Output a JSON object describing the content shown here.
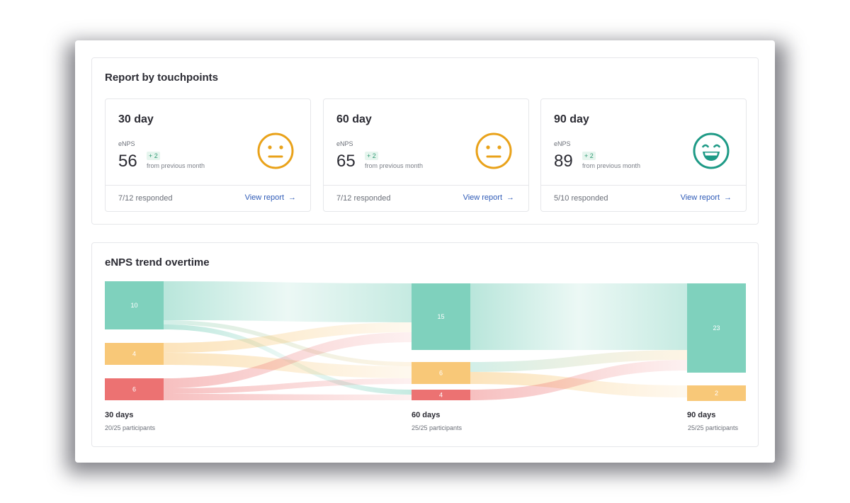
{
  "touchpoints": {
    "title": "Report by touchpoints",
    "cards": [
      {
        "title": "30 day",
        "metric_label": "eNPS",
        "score": "56",
        "delta": "+ 2",
        "delta_note": "from previous month",
        "responded": "7/12 responded",
        "link": "View report",
        "face": "neutral-face-icon",
        "face_color": "#e9a21a"
      },
      {
        "title": "60 day",
        "metric_label": "eNPS",
        "score": "65",
        "delta": "+ 2",
        "delta_note": "from previous month",
        "responded": "7/12 responded",
        "link": "View report",
        "face": "neutral-face-icon",
        "face_color": "#e9a21a"
      },
      {
        "title": "90 day",
        "metric_label": "eNPS",
        "score": "89",
        "delta": "+ 2",
        "delta_note": "from previous month",
        "responded": "5/10 responded",
        "link": "View report",
        "face": "grinning-face-icon",
        "face_color": "#1e9a86"
      }
    ]
  },
  "trend": {
    "title": "eNPS trend overtime",
    "colors": {
      "promoter": "#7fd1bd",
      "passive": "#f8c878",
      "detractor": "#ec7272"
    },
    "stages": [
      {
        "name": "30 days",
        "participants": "20/25 participants",
        "nodes": [
          {
            "label": "10",
            "group": "promoter",
            "value": 10
          },
          {
            "label": "4",
            "group": "passive",
            "value": 4
          },
          {
            "label": "6",
            "group": "detractor",
            "value": 6
          }
        ]
      },
      {
        "name": "60 days",
        "participants": "25/25 participants",
        "nodes": [
          {
            "label": "15",
            "group": "promoter",
            "value": 15
          },
          {
            "label": "6",
            "group": "passive",
            "value": 6
          },
          {
            "label": "4",
            "group": "detractor",
            "value": 4
          }
        ]
      },
      {
        "name": "90 days",
        "participants": "25/25 participants",
        "nodes": [
          {
            "label": "23",
            "group": "promoter",
            "value": 23
          },
          {
            "label": "2",
            "group": "passive",
            "value": 2
          }
        ]
      }
    ]
  }
}
